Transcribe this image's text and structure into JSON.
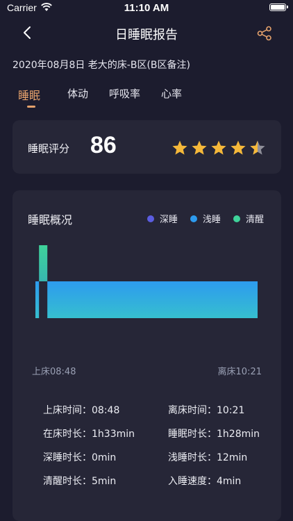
{
  "status_bar": {
    "carrier": "Carrier",
    "time": "11:10 AM"
  },
  "nav": {
    "title": "日睡眠报告"
  },
  "subtitle": "2020年08月8日 老大的床-B区(B区备注)",
  "tabs": [
    {
      "label": "睡眠",
      "active": true
    },
    {
      "label": "体动",
      "active": false
    },
    {
      "label": "呼吸率",
      "active": false
    },
    {
      "label": "心率",
      "active": false
    }
  ],
  "score": {
    "label": "睡眠评分",
    "value": "86",
    "stars_filled": 4,
    "stars_total": 5
  },
  "overview": {
    "heading": "睡眠概况",
    "legend": [
      {
        "name": "深睡",
        "color": "#5b5de0"
      },
      {
        "name": "浅睡",
        "color": "#2d9bef"
      },
      {
        "name": "清醒",
        "color": "#3fd39a"
      }
    ],
    "start_label": "上床08:48",
    "end_label": "离床10:21"
  },
  "stats": [
    {
      "label": "上床时间：",
      "value": "08:48"
    },
    {
      "label": "离床时间：",
      "value": "10:21"
    },
    {
      "label": "在床时长：",
      "value": "1h33min"
    },
    {
      "label": "睡眠时长：",
      "value": "1h28min"
    },
    {
      "label": "深睡时长：",
      "value": "0min"
    },
    {
      "label": "浅睡时长：",
      "value": "12min"
    },
    {
      "label": "清醒时长：",
      "value": "5min"
    },
    {
      "label": "入睡速度：",
      "value": "4min"
    }
  ],
  "chart_data": {
    "type": "bar",
    "x_range": [
      "08:48",
      "10:21"
    ],
    "segments": [
      {
        "stage": "浅睡",
        "start_min": 0,
        "duration_min": 1.5
      },
      {
        "stage": "清醒",
        "start_min": 1.5,
        "duration_min": 3.5
      },
      {
        "stage": "浅睡",
        "start_min": 5,
        "duration_min": 88
      }
    ],
    "stage_levels": {
      "深睡": 0,
      "浅睡": 1,
      "清醒": 2
    },
    "colors": {
      "深睡": "#5b5de0",
      "浅睡": "#2d9bef",
      "清醒": "#3fd39a"
    }
  }
}
